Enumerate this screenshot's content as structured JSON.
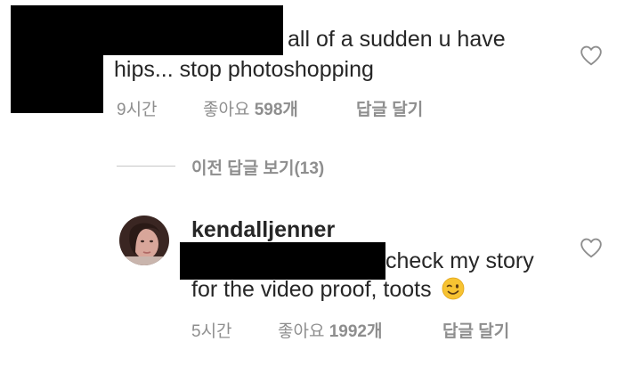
{
  "comment1": {
    "text_line1": "all of a sudden u have",
    "text_line2": "hips... stop photoshopping",
    "time": "9시간",
    "likes_label": "좋아요",
    "likes_count": "598개",
    "reply": "답글 달기"
  },
  "view_replies": "이전 답글 보기(13)",
  "reply1": {
    "username": "kendalljenner",
    "text_line1": "check my story",
    "text_line2": "for the video proof, toots",
    "emoji": "winking-face",
    "time": "5시간",
    "likes_label": "좋아요",
    "likes_count": "1992개",
    "reply": "답글 달기"
  },
  "colors": {
    "text": "#262626",
    "meta": "#8e8e8e",
    "redaction": "#000000",
    "emoji": "#f7c332"
  }
}
